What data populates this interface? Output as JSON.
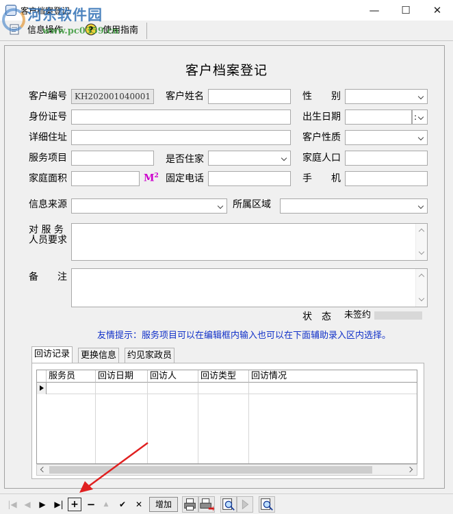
{
  "window": {
    "title": "客户档案登记",
    "minimize": "—",
    "maximize": "☐",
    "close": "✕"
  },
  "watermark": {
    "logo": "河东软件园",
    "url": "www.pc0359.cn"
  },
  "menu": [
    {
      "label": "信息操作",
      "icon": "document-icon"
    },
    {
      "label": "使用指南",
      "icon": "help-icon"
    }
  ],
  "form": {
    "title": "客户档案登记",
    "customer_no_label": "客户编号",
    "customer_no_value": "KH202001040001",
    "customer_name_label": "客户姓名",
    "customer_name_value": "",
    "gender_label": "性　　别",
    "gender_value": "",
    "id_no_label": "身份证号",
    "id_no_value": "",
    "birthdate_label": "出生日期",
    "birthdate_value": "",
    "birthdate_sep": ":",
    "address_label": "详细住址",
    "address_value": "",
    "customer_type_label": "客户性质",
    "customer_type_value": "",
    "service_label": "服务项目",
    "service_value": "",
    "live_in_label": "是否住家",
    "live_in_value": "",
    "family_size_label": "家庭人口",
    "family_size_value": "",
    "area_label": "家庭面积",
    "area_value": "",
    "area_unit": "M",
    "area_unit_sup": "2",
    "phone_label": "固定电话",
    "phone_value": "",
    "mobile_label": "手　　机",
    "mobile_value": "",
    "source_label": "信息来源",
    "source_value": "",
    "region_label": "所属区域",
    "region_value": "",
    "requirement_label_1": "对 服 务",
    "requirement_label_2": "人员要求",
    "requirement_value": "",
    "remark_label": "备　　注",
    "remark_value": "",
    "status_label": "状　态",
    "status_value": "未签约",
    "tip": "友情提示：服务项目可以在编辑框内输入也可以在下面辅助录入区内选择。"
  },
  "tabs": [
    {
      "label": "回访记录",
      "active": true
    },
    {
      "label": "更换信息",
      "active": false
    },
    {
      "label": "约见家政员",
      "active": false
    }
  ],
  "grid": {
    "columns": [
      "服务员",
      "回访日期",
      "回访人",
      "回访类型",
      "回访情况"
    ],
    "rows": []
  },
  "navigator": {
    "first": "|◀",
    "prior": "◀",
    "next": "▶",
    "last": "▶|",
    "insert": "+",
    "delete": "−",
    "edit": "▲",
    "post": "✔",
    "cancel": "✕",
    "add_label": "增加"
  }
}
